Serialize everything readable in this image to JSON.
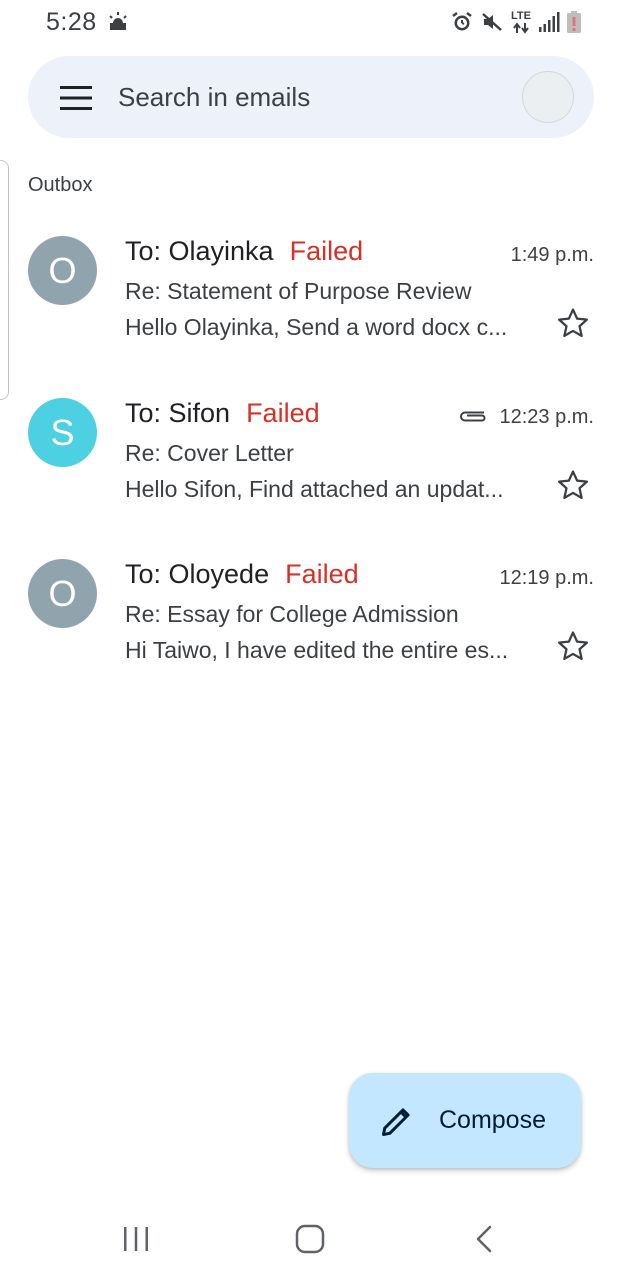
{
  "status_bar": {
    "time": "5:28",
    "weather_icon": "sunrise-cloud-icon",
    "icons": [
      "alarm-icon",
      "mute-icon",
      "lte-icon",
      "signal-icon",
      "battery-icon"
    ],
    "network_label": "LTE"
  },
  "search": {
    "placeholder": "Search in emails",
    "menu_icon": "hamburger-menu-icon"
  },
  "section": {
    "label": "Outbox"
  },
  "emails": [
    {
      "avatar_letter": "O",
      "avatar_color": "#90a4ae",
      "recipient": "To: Olayinka",
      "status": "Failed",
      "time": "1:49 p.m.",
      "has_attachment": false,
      "subject": "Re: Statement of Purpose Review",
      "snippet": "Hello Olayinka, Send a word docx c..."
    },
    {
      "avatar_letter": "S",
      "avatar_color": "#4dd0e1",
      "recipient": "To: Sifon",
      "status": "Failed",
      "time": "12:23 p.m.",
      "has_attachment": true,
      "subject": "Re: Cover Letter",
      "snippet": "Hello Sifon, Find attached an updat..."
    },
    {
      "avatar_letter": "O",
      "avatar_color": "#90a4ae",
      "recipient": "To: Oloyede",
      "status": "Failed",
      "time": "12:19 p.m.",
      "has_attachment": false,
      "subject": "Re: Essay for College Admission",
      "snippet": "Hi Taiwo, I have edited the entire es..."
    }
  ],
  "compose": {
    "label": "Compose",
    "icon": "pencil-icon",
    "color": "#c2e7ff"
  },
  "nav_bar": {
    "icons": [
      "recent-apps-icon",
      "home-icon",
      "back-icon"
    ]
  },
  "colors": {
    "failed": "#d93025",
    "search_bg": "#edf2fa"
  }
}
